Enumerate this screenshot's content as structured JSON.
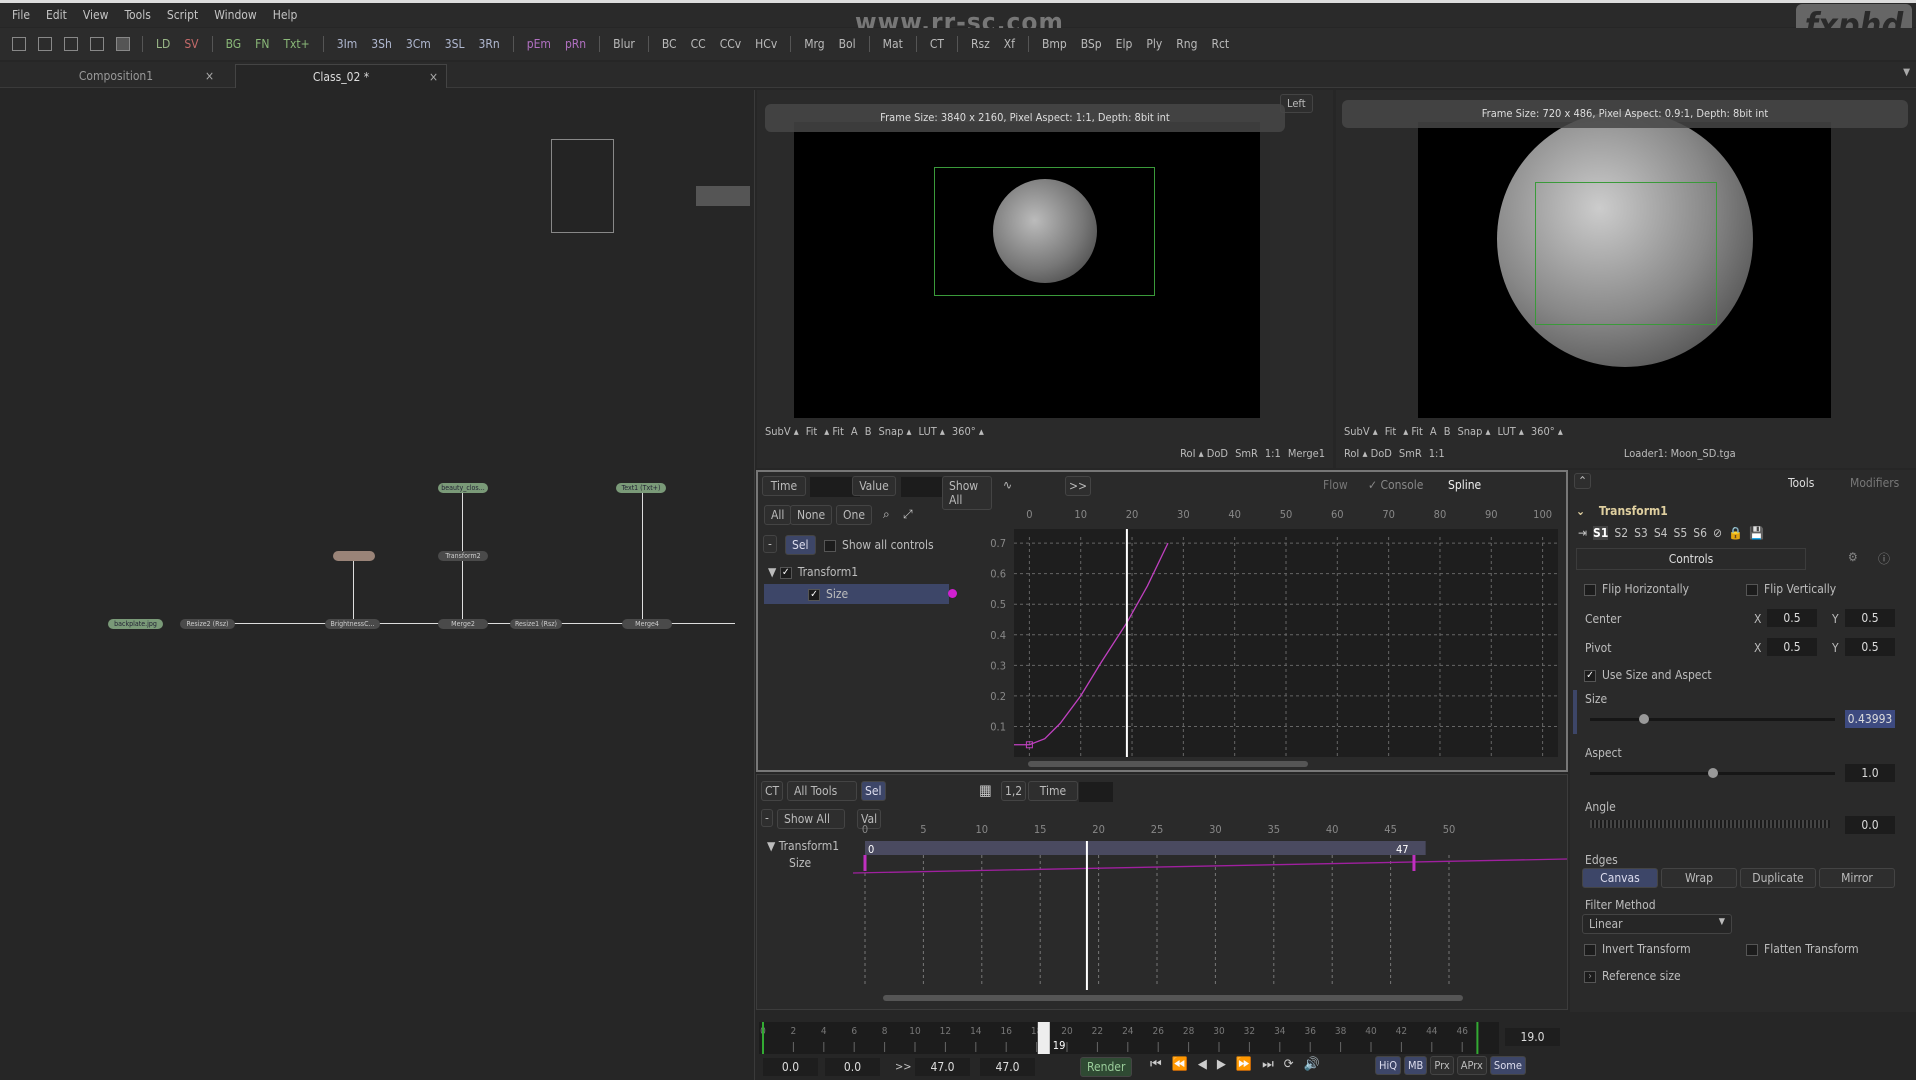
{
  "menu": [
    "File",
    "Edit",
    "View",
    "Tools",
    "Script",
    "Window",
    "Help"
  ],
  "watermark": "www.rr-sc.com",
  "logo": "fxphd",
  "toolbar": [
    {
      "l": "LD",
      "c": "#9ab888"
    },
    {
      "l": "SV",
      "c": "#c46a6a"
    },
    {
      "sep": true
    },
    {
      "l": "BG",
      "c": "#8ab878"
    },
    {
      "l": "FN",
      "c": "#8ab878"
    },
    {
      "l": "Txt+",
      "c": "#8ab878"
    },
    {
      "sep": true
    },
    {
      "l": "3Im",
      "c": "#b0b8d0"
    },
    {
      "l": "3Sh",
      "c": "#b0b8d0"
    },
    {
      "l": "3Cm",
      "c": "#b0b8d0"
    },
    {
      "l": "3SL",
      "c": "#b0b8d0"
    },
    {
      "l": "3Rn",
      "c": "#b0b8d0"
    },
    {
      "sep": true
    },
    {
      "l": "pEm",
      "c": "#b070c0"
    },
    {
      "l": "pRn",
      "c": "#b070c0"
    },
    {
      "sep": true
    },
    {
      "l": "Blur"
    },
    {
      "sep": true
    },
    {
      "l": "BC"
    },
    {
      "l": "CC"
    },
    {
      "l": "CCv"
    },
    {
      "l": "HCv"
    },
    {
      "sep": true
    },
    {
      "l": "Mrg"
    },
    {
      "l": "Bol"
    },
    {
      "sep": true
    },
    {
      "l": "Mat"
    },
    {
      "sep": true
    },
    {
      "l": "CT"
    },
    {
      "sep": true
    },
    {
      "l": "Rsz"
    },
    {
      "l": "Xf"
    },
    {
      "sep": true
    },
    {
      "l": "Bmp"
    },
    {
      "l": "BSp"
    },
    {
      "l": "Elp"
    },
    {
      "l": "Ply"
    },
    {
      "l": "Rng"
    },
    {
      "l": "Rct"
    }
  ],
  "tabs": [
    {
      "label": "Composition1",
      "close": "×"
    },
    {
      "label": "Class_02 *",
      "close": "×"
    }
  ],
  "nodes": {
    "backplate": "backplate.jpg",
    "resize2": "Resize2 (Rsz)",
    "brightness": "BrightnessC...",
    "merge2": "Merge2",
    "resize1": "Resize1 (Rsz)",
    "merge4": "Merge4",
    "beauty": "beauty_clos...",
    "transform2": "Transform2",
    "text1": "Text1 (Txt+)"
  },
  "viewer_left": {
    "info": "Frame Size: 3840 x 2160, Pixel Aspect: 1:1, Depth: 8bit int",
    "badge": "Left",
    "row1": [
      "SubV ▴",
      "Fit",
      "▴ Fit",
      "A",
      "B",
      "Snap ▴",
      "LUT ▴",
      "360° ▴"
    ],
    "row2": [
      "RoI ▴ DoD",
      "SmR",
      "1:1"
    ],
    "name": "Merge1"
  },
  "viewer_right": {
    "info": "Frame Size: 720 x 486, Pixel Aspect: 0.9:1, Depth: 8bit int",
    "row1": [
      "SubV ▴",
      "Fit",
      "▴ Fit",
      "A",
      "B",
      "Snap ▴",
      "LUT ▴",
      "360° ▴"
    ],
    "row2": [
      "RoI ▴ DoD",
      "SmR",
      "1:1"
    ],
    "name": "Loader1: Moon_SD.tga"
  },
  "spline": {
    "time_label": "Time",
    "value_label": "Value",
    "show_all": "Show All",
    "more": ">>",
    "tabs": [
      "Flow",
      "Console",
      "Spline"
    ],
    "filters": [
      "All",
      "None",
      "One"
    ],
    "minus": "-",
    "sel": "Sel",
    "show_all_controls": "Show all controls",
    "tree": {
      "tool": "Transform1",
      "param": "Size"
    },
    "chart_data": {
      "type": "line",
      "x_ticks": [
        0,
        10,
        20,
        30,
        40,
        50,
        60,
        70,
        80,
        90,
        100
      ],
      "y_ticks": [
        0.1,
        0.2,
        0.3,
        0.4,
        0.5,
        0.6,
        0.7
      ],
      "xlim": [
        -3,
        103
      ],
      "ylim": [
        0,
        0.72
      ],
      "current_time": 19,
      "grid": true,
      "series": [
        {
          "color": "#c040c0",
          "points": [
            [
              -3,
              0.04
            ],
            [
              0,
              0.04
            ],
            [
              3,
              0.06
            ],
            [
              6,
              0.11
            ],
            [
              10,
              0.2
            ],
            [
              14,
              0.31
            ],
            [
              19,
              0.44
            ],
            [
              23,
              0.56
            ],
            [
              27,
              0.7
            ]
          ]
        }
      ]
    }
  },
  "timeline": {
    "ct": "CT",
    "all_tools": "All Tools",
    "sel": "Sel",
    "scale": "1,2",
    "time": "Time",
    "show_all": "Show All",
    "val": "Val",
    "minus": "-",
    "tool": "Transform1",
    "param": "Size",
    "ticks": [
      0,
      5,
      10,
      15,
      20,
      25,
      30,
      35,
      40,
      45,
      50
    ],
    "range_start": "0",
    "range_end": "47",
    "current_time": 19,
    "key_start": 0,
    "key_end": 47
  },
  "inspector": {
    "tabs": [
      "Tools",
      "Modifiers"
    ],
    "tool": "Transform1",
    "versions": [
      "S1",
      "S2",
      "S3",
      "S4",
      "S5",
      "S6"
    ],
    "controls_tab": "Controls",
    "flip_h": "Flip Horizontally",
    "flip_v": "Flip Vertically",
    "center": {
      "label": "Center",
      "x_label": "X",
      "x": "0.5",
      "y_label": "Y",
      "y": "0.5"
    },
    "pivot": {
      "label": "Pivot",
      "x_label": "X",
      "x": "0.5",
      "y_label": "Y",
      "y": "0.5"
    },
    "use_size": "Use Size and Aspect",
    "use_size_checked": true,
    "size": {
      "label": "Size",
      "value": "0.43993",
      "fraction": 0.22
    },
    "aspect": {
      "label": "Aspect",
      "value": "1.0",
      "fraction": 0.5
    },
    "angle": {
      "label": "Angle",
      "value": "0.0"
    },
    "edges": {
      "label": "Edges",
      "options": [
        "Canvas",
        "Wrap",
        "Duplicate",
        "Mirror"
      ],
      "selected": "Canvas"
    },
    "filter": {
      "label": "Filter Method",
      "value": "Linear"
    },
    "invert": "Invert Transform",
    "flatten": "Flatten Transform",
    "ref": "Reference size"
  },
  "transport": {
    "ruler_ticks": [
      0,
      2,
      4,
      6,
      8,
      10,
      12,
      14,
      16,
      18,
      20,
      22,
      24,
      26,
      28,
      30,
      32,
      34,
      36,
      38,
      40,
      42,
      44,
      46
    ],
    "current": "19",
    "current_display": "19.0",
    "global_start": "0.0",
    "render_start": "0.0",
    "render_end": "47.0",
    "global_end": "47.0",
    "arrows": ">>",
    "render": "Render",
    "toggles": [
      "HiQ",
      "MB",
      "Prx",
      "APrx",
      "Some"
    ],
    "toggles_on": [
      "HiQ",
      "MB",
      "Some"
    ]
  }
}
